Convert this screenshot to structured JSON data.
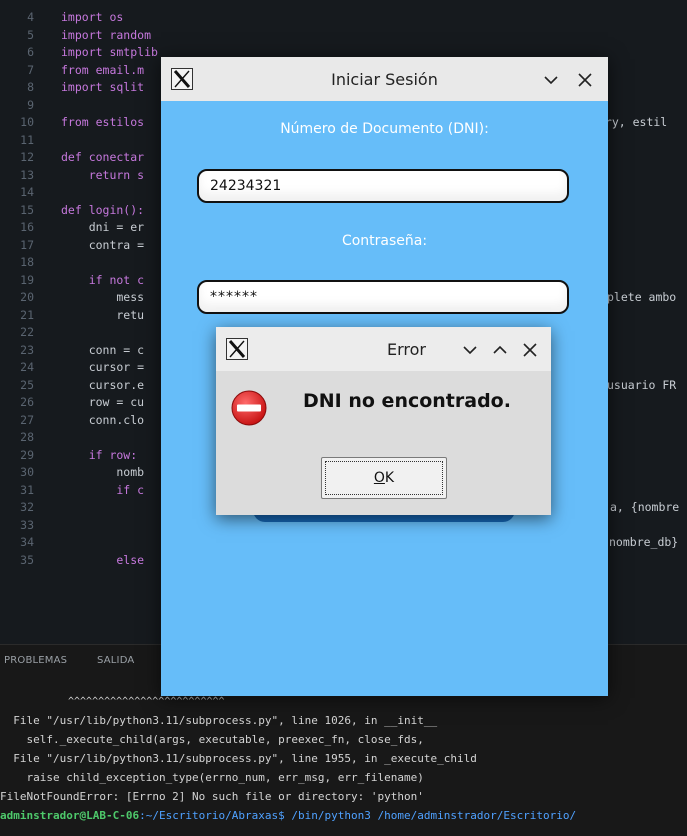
{
  "editor": {
    "lines": [
      {
        "n": "4",
        "code": "import os"
      },
      {
        "n": "5",
        "code": "import random"
      },
      {
        "n": "6",
        "code": "import smtplib"
      },
      {
        "n": "7",
        "code": "from email.m"
      },
      {
        "n": "8",
        "code": "import sqlit"
      },
      {
        "n": "9",
        "code": ""
      },
      {
        "n": "10",
        "code": "from estilos"
      },
      {
        "n": "11",
        "code": ""
      },
      {
        "n": "12",
        "code": "def conectar"
      },
      {
        "n": "13",
        "code": "    return s"
      },
      {
        "n": "14",
        "code": ""
      },
      {
        "n": "15",
        "code": "def login():"
      },
      {
        "n": "16",
        "code": "    dni = er"
      },
      {
        "n": "17",
        "code": "    contra ="
      },
      {
        "n": "18",
        "code": ""
      },
      {
        "n": "19",
        "code": "    if not c"
      },
      {
        "n": "20",
        "code": "        mess"
      },
      {
        "n": "21",
        "code": "        retu"
      },
      {
        "n": "22",
        "code": ""
      },
      {
        "n": "23",
        "code": "    conn = c"
      },
      {
        "n": "24",
        "code": "    cursor ="
      },
      {
        "n": "25",
        "code": "    cursor.e"
      },
      {
        "n": "26",
        "code": "    row = cu"
      },
      {
        "n": "27",
        "code": "    conn.clo"
      },
      {
        "n": "28",
        "code": ""
      },
      {
        "n": "29",
        "code": "    if row:"
      },
      {
        "n": "30",
        "code": "        nomb"
      },
      {
        "n": "31",
        "code": "        if c"
      },
      {
        "n": "32",
        "code": ""
      },
      {
        "n": "33",
        "code": ""
      },
      {
        "n": "34",
        "code": ""
      },
      {
        "n": "35",
        "code": "        else"
      }
    ],
    "right_fragments": {
      "l10": "try, estil",
      "l20": "plete ambo",
      "l25": "usuario FR",
      "l32": "a, {nombre",
      "l34": "nombre_db}"
    }
  },
  "panel": {
    "tabs": [
      "PROBLEMAS",
      "SALIDA"
    ],
    "terminal": {
      "carets": "^^^^^^^^^^^^^^^^^^^^^^^^^^",
      "l1": "  File \"/usr/lib/python3.11/subprocess.py\", line 1026, in __init__",
      "l2": "    self._execute_child(args, executable, preexec_fn, close_fds,",
      "l3": "  File \"/usr/lib/python3.11/subprocess.py\", line 1955, in _execute_child",
      "l4": "    raise child_exception_type(errno_num, err_msg, err_filename)",
      "l5": "FileNotFoundError: [Errno 2] No such file or directory: 'python'",
      "l6_user": "adminstrador@LAB-C-06",
      "l6_rest": ":~/Escritorio/Abraxas$ /bin/python3 /home/adminstrador/Escritorio/"
    }
  },
  "login": {
    "title": "Iniciar Sesión",
    "dni_label": "Número de Documento (DNI):",
    "dni_value": "24234321",
    "pass_label": "Contraseña:",
    "pass_value": "******"
  },
  "error": {
    "title": "Error",
    "message": "DNI no encontrado.",
    "ok_underlined": "O",
    "ok_rest": "K"
  },
  "colors": {
    "login_bg": "#66bdf9",
    "titlebar": "#e9e9e9",
    "dialog_bg": "#dcdcdc",
    "error_icon": "#e02424"
  }
}
